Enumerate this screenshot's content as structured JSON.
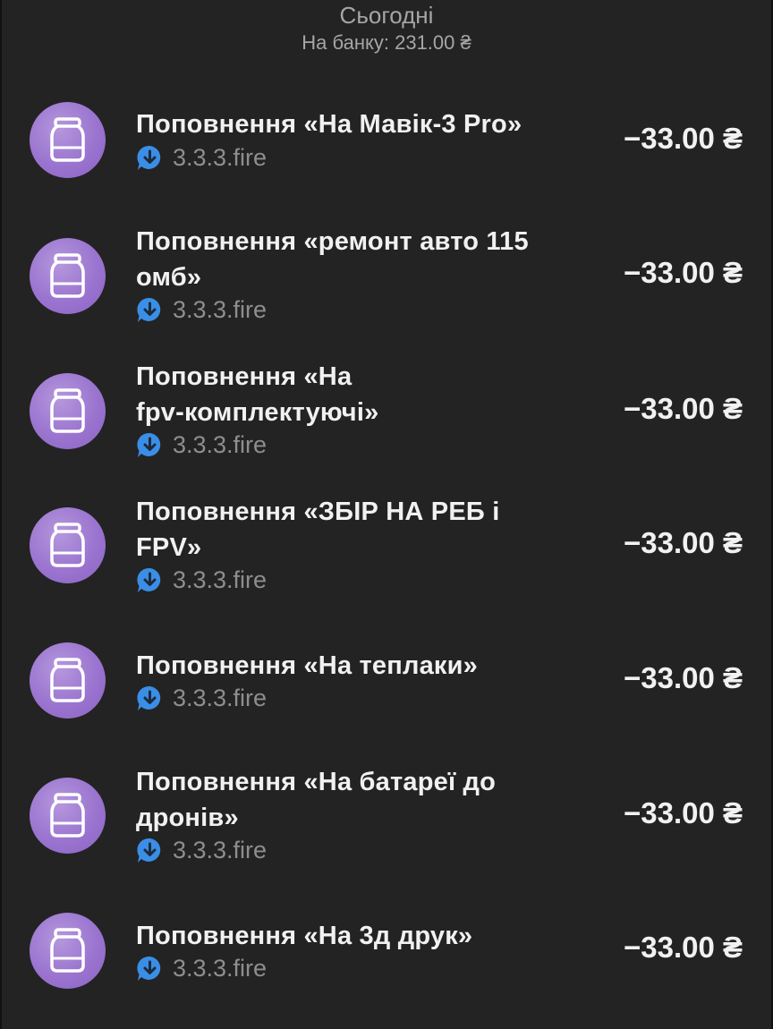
{
  "header": {
    "title": "Сьогодні",
    "balance_label": "На банку: 231.00 ₴"
  },
  "transactions": [
    {
      "title_line1": "Поповнення «На Мавік-3 Pro»",
      "title_line2": "",
      "source": "3.3.3.fire",
      "amount": "−33.00 ₴"
    },
    {
      "title_line1": "Поповнення «ремонт авто 115",
      "title_line2": "омб»",
      "source": "3.3.3.fire",
      "amount": "−33.00 ₴"
    },
    {
      "title_line1": "Поповнення «На",
      "title_line2": "fpv-комплектуючі»",
      "source": "3.3.3.fire",
      "amount": "−33.00 ₴"
    },
    {
      "title_line1": "Поповнення «ЗБІР НА РЕБ і",
      "title_line2": "FPV»",
      "source": "3.3.3.fire",
      "amount": "−33.00 ₴"
    },
    {
      "title_line1": "Поповнення «На теплаки»",
      "title_line2": "",
      "source": "3.3.3.fire",
      "amount": "−33.00 ₴"
    },
    {
      "title_line1": "Поповнення «На батареї до",
      "title_line2": "дронів»",
      "source": "3.3.3.fire",
      "amount": "−33.00 ₴"
    },
    {
      "title_line1": "Поповнення «На 3д друк»",
      "title_line2": "",
      "source": "3.3.3.fire",
      "amount": "−33.00 ₴"
    }
  ],
  "icons": {
    "avatar": "jar-icon",
    "source": "chat-arrow-down-icon"
  },
  "colors": {
    "background": "#232323",
    "avatar": "#9a74cf",
    "source_icon": "#3a8ee6",
    "muted_text": "#8e8e8e"
  }
}
